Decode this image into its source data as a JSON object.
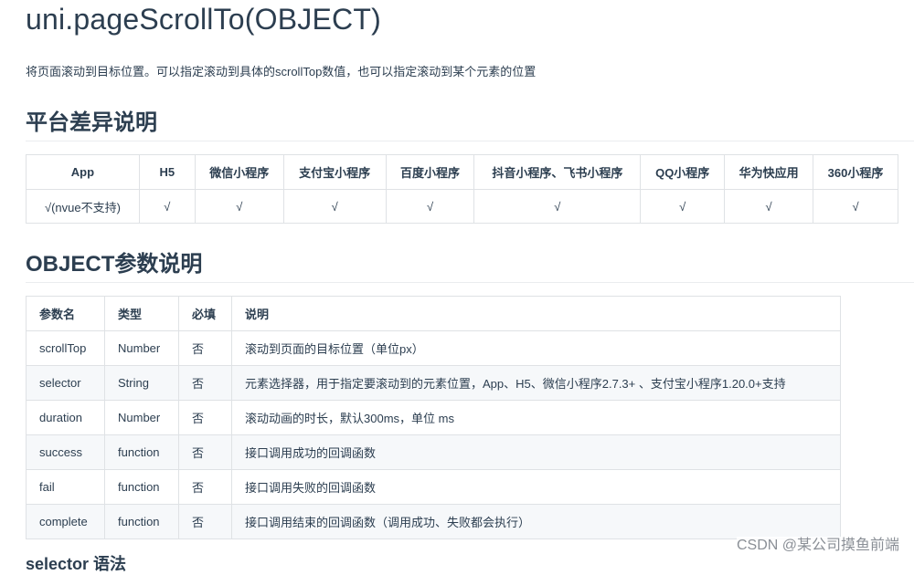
{
  "page": {
    "title": "uni.pageScrollTo(OBJECT)",
    "description": "将页面滚动到目标位置。可以指定滚动到具体的scrollTop数值，也可以指定滚动到某个元素的位置"
  },
  "platform_section": {
    "heading": "平台差异说明",
    "headers": [
      "App",
      "H5",
      "微信小程序",
      "支付宝小程序",
      "百度小程序",
      "抖音小程序、飞书小程序",
      "QQ小程序",
      "华为快应用",
      "360小程序"
    ],
    "row": [
      "√(nvue不支持)",
      "√",
      "√",
      "√",
      "√",
      "√",
      "√",
      "√",
      "√"
    ]
  },
  "object_section": {
    "heading": "OBJECT参数说明",
    "headers": [
      "参数名",
      "类型",
      "必填",
      "说明"
    ],
    "rows": [
      [
        "scrollTop",
        "Number",
        "否",
        "滚动到页面的目标位置（单位px）"
      ],
      [
        "selector",
        "String",
        "否",
        "元素选择器，用于指定要滚动到的元素位置，App、H5、微信小程序2.7.3+ 、支付宝小程序1.20.0+支持"
      ],
      [
        "duration",
        "Number",
        "否",
        "滚动动画的时长，默认300ms，单位 ms"
      ],
      [
        "success",
        "function",
        "否",
        "接口调用成功的回调函数"
      ],
      [
        "fail",
        "function",
        "否",
        "接口调用失败的回调函数"
      ],
      [
        "complete",
        "function",
        "否",
        "接口调用结束的回调函数（调用成功、失败都会执行）"
      ]
    ]
  },
  "next_heading": "selector 语法",
  "watermark": "CSDN @某公司摸鱼前端"
}
